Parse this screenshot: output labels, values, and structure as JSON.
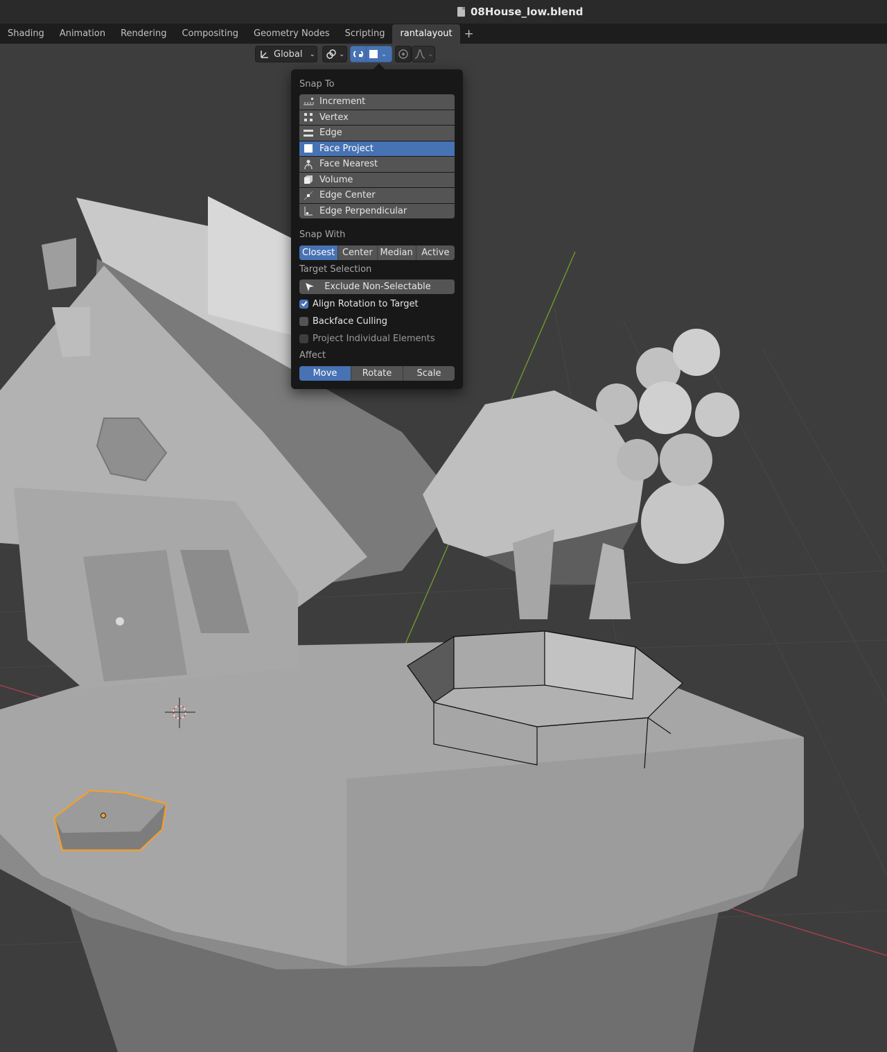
{
  "window": {
    "title": "08House_low.blend",
    "file_icon": "blend-file-icon"
  },
  "workspace_tabs": [
    {
      "label": "Shading",
      "active": false
    },
    {
      "label": "Animation",
      "active": false
    },
    {
      "label": "Rendering",
      "active": false
    },
    {
      "label": "Compositing",
      "active": false
    },
    {
      "label": "Geometry Nodes",
      "active": false
    },
    {
      "label": "Scripting",
      "active": false
    },
    {
      "label": "rantalayout",
      "active": true
    }
  ],
  "add_tab_label": "+",
  "header": {
    "orientation_label": "Global",
    "pivot_icon": "pivot-link-icon",
    "snap_icon": "magnet-icon",
    "snap_target_icon": "face-project-icon",
    "proportional_icon": "proportional-edit-icon",
    "falloff_icon": "falloff-curve-icon"
  },
  "snap_panel": {
    "snap_to_label": "Snap To",
    "snap_to_items": [
      {
        "label": "Increment",
        "icon": "increment-icon",
        "selected": false
      },
      {
        "label": "Vertex",
        "icon": "vertex-icon",
        "selected": false
      },
      {
        "label": "Edge",
        "icon": "edge-icon",
        "selected": false
      },
      {
        "label": "Face Project",
        "icon": "face-project-icon",
        "selected": true
      },
      {
        "label": "Face Nearest",
        "icon": "face-nearest-icon",
        "selected": false
      },
      {
        "label": "Volume",
        "icon": "volume-icon",
        "selected": false
      },
      {
        "label": "Edge Center",
        "icon": "edge-center-icon",
        "selected": false
      },
      {
        "label": "Edge Perpendicular",
        "icon": "edge-perpendicular-icon",
        "selected": false
      }
    ],
    "snap_with_label": "Snap With",
    "snap_with_options": [
      {
        "label": "Closest",
        "on": true
      },
      {
        "label": "Center",
        "on": false
      },
      {
        "label": "Median",
        "on": false
      },
      {
        "label": "Active",
        "on": false
      }
    ],
    "target_selection_label": "Target Selection",
    "exclude_label": "Exclude Non-Selectable",
    "exclude_icon": "cursor-arrow-icon",
    "checkboxes": [
      {
        "label": "Align Rotation to Target",
        "checked": true,
        "enabled": true
      },
      {
        "label": "Backface Culling",
        "checked": false,
        "enabled": true
      },
      {
        "label": "Project Individual Elements",
        "checked": false,
        "enabled": false
      }
    ],
    "affect_label": "Affect",
    "affect_options": [
      {
        "label": "Move",
        "on": true
      },
      {
        "label": "Rotate",
        "on": false
      },
      {
        "label": "Scale",
        "on": false
      }
    ]
  },
  "colors": {
    "accent": "#4772b3",
    "viewport_bg": "#3d3d3d",
    "selection_outline": "#f5a029",
    "axis_x": "#a8404a",
    "axis_y": "#6f9a2c"
  }
}
